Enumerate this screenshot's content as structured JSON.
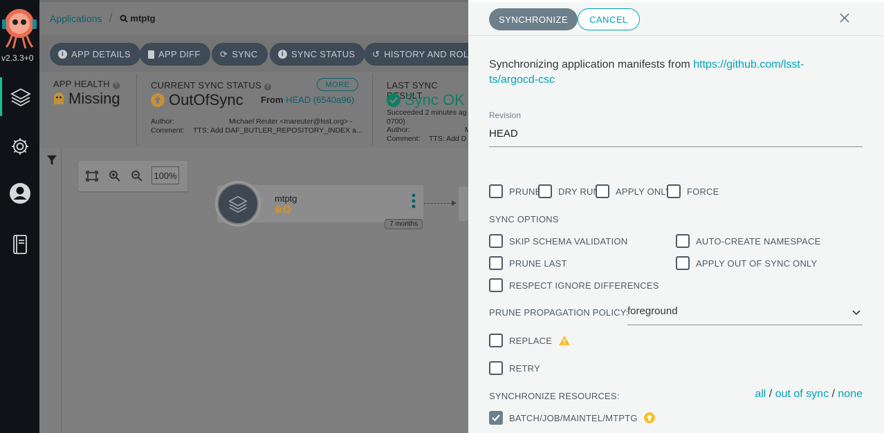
{
  "sidebar": {
    "version": "v2.3.3+0",
    "items": [
      {
        "name": "applications",
        "icon": "layers-icon"
      },
      {
        "name": "settings",
        "icon": "gear-icon"
      },
      {
        "name": "user-info",
        "icon": "user-icon"
      },
      {
        "name": "documentation",
        "icon": "book-icon"
      }
    ]
  },
  "breadcrumb": {
    "root": "Applications",
    "separator": "/",
    "current": "mtptg"
  },
  "toolbar": {
    "app_details": "APP DETAILS",
    "app_diff": "APP DIFF",
    "sync": "SYNC",
    "sync_status": "SYNC STATUS",
    "history": "HISTORY AND ROLLBACK"
  },
  "status": {
    "app_health_label": "APP HEALTH",
    "app_health_value": "Missing",
    "sync_status_label": "CURRENT SYNC STATUS",
    "sync_status_value": "OutOfSync",
    "more": "MORE",
    "from_label": "From",
    "from_value": "HEAD (6540a96)",
    "author_label": "Author:",
    "author_value": "Michael Reuter <mareuter@lsst.org> -",
    "comment_label": "Comment:",
    "comment_value": "TTS: Add DAF_BUTLER_REPOSITORY_INDEX a...",
    "last_sync_label": "LAST SYNC RESULT",
    "last_sync_value": "Sync OK",
    "last_sync_detail": "Succeeded 2 minutes ag",
    "last_sync_detail2": "0700)",
    "last_author_label": "Author:",
    "last_author_value": "M",
    "last_comment_label": "Comment:",
    "last_comment_value": "TTS: Add D"
  },
  "canvas": {
    "zoom_level": "100%",
    "node_name": "mtptg",
    "node_age": "7 months"
  },
  "panel": {
    "synchronize_button": "SYNCHRONIZE",
    "cancel_button": "CANCEL",
    "intro_text": "Synchronizing application manifests from ",
    "repo_url": "https://github.com/lsst-ts/argocd-csc",
    "revision_label": "Revision",
    "revision_value": "HEAD",
    "options": {
      "prune": "PRUNE",
      "dry_run": "DRY RUN",
      "apply_only": "APPLY ONLY",
      "force": "FORCE"
    },
    "sync_options_label": "SYNC OPTIONS",
    "sync_options": {
      "skip_schema": "SKIP SCHEMA VALIDATION",
      "auto_create_ns": "AUTO-CREATE NAMESPACE",
      "prune_last": "PRUNE LAST",
      "apply_out_of_sync": "APPLY OUT OF SYNC ONLY",
      "respect_ignore": "RESPECT IGNORE DIFFERENCES"
    },
    "prune_policy_label": "PRUNE PROPAGATION POLICY:",
    "prune_policy_value": "foreground",
    "replace": "REPLACE",
    "retry": "RETRY",
    "sync_resources_label": "SYNCHRONIZE RESOURCES:",
    "res_all": "all",
    "res_out_of_sync": "out of sync",
    "res_none": "none",
    "res_sep": " / ",
    "resource": {
      "name": "BATCH/JOB/MAINTEL/MTPTG",
      "checked": true
    }
  },
  "colors": {
    "accent": "#00a2b3",
    "out_of_sync": "#f4c030",
    "sync_ok": "#18be94",
    "warning": "#f4c030"
  }
}
